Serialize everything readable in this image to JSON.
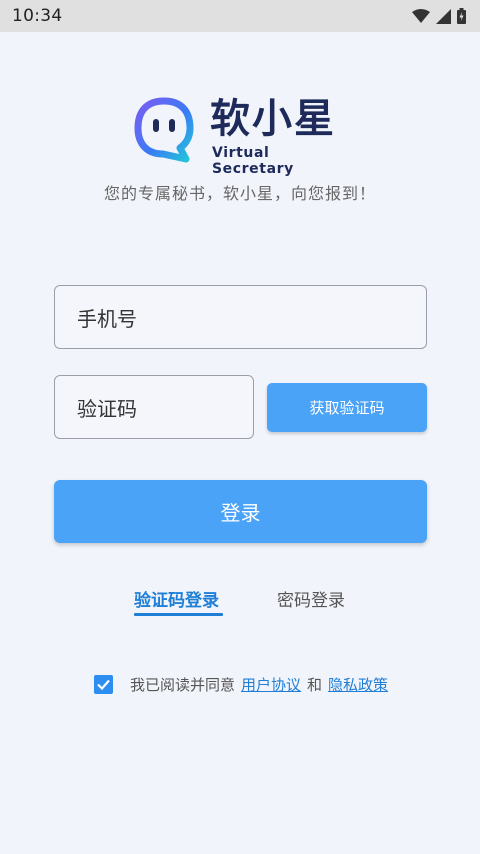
{
  "status_bar": {
    "time": "10:34"
  },
  "brand": {
    "name": "软小星",
    "subtitle": "Virtual Secretary",
    "tagline": "您的专属秘书，软小星，向您报到！"
  },
  "form": {
    "phone_placeholder": "手机号",
    "code_placeholder": "验证码",
    "get_code_label": "获取验证码",
    "login_label": "登录"
  },
  "tabs": [
    {
      "label": "验证码登录",
      "active": true
    },
    {
      "label": "密码登录",
      "active": false
    }
  ],
  "agreement": {
    "checked": true,
    "prefix": "我已阅读并同意",
    "user_agreement": "用户协议",
    "conjunction": "和",
    "privacy_policy": "隐私政策"
  },
  "colors": {
    "accent": "#4aa3f7",
    "link": "#1f7fd6",
    "brand_dark": "#1d2a5a",
    "background": "#f2f4fb"
  },
  "icons": [
    "wifi-icon",
    "cellular-signal-icon",
    "battery-icon",
    "logo-chat-bubble-icon",
    "checkmark-icon"
  ]
}
